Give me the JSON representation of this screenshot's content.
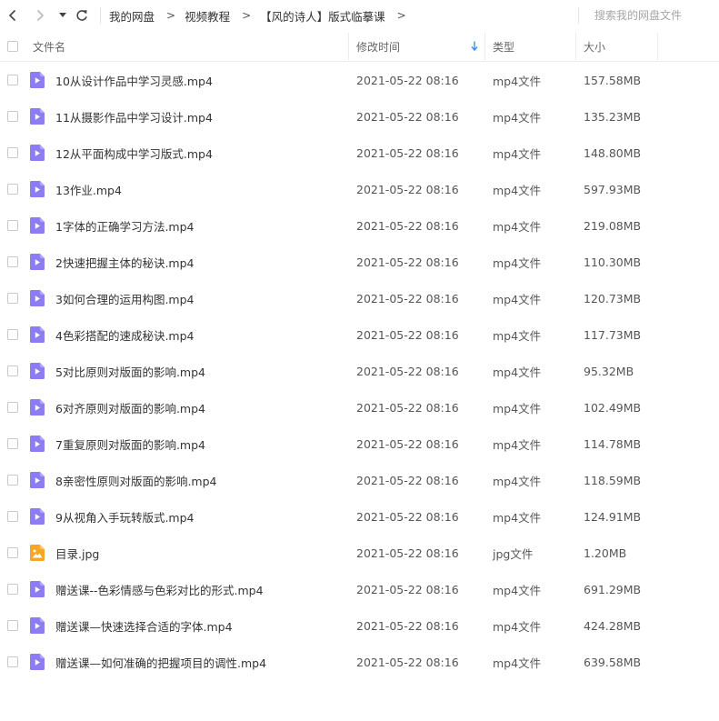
{
  "breadcrumb": [
    {
      "label": "我的网盘"
    },
    {
      "label": "视频教程"
    },
    {
      "label": "【风的诗人】版式临摹课"
    }
  ],
  "breadcrumb_separator": ">",
  "search": {
    "placeholder": "搜索我的网盘文件"
  },
  "columns": {
    "name": "文件名",
    "mtime": "修改时间",
    "type": "类型",
    "size": "大小"
  },
  "colors": {
    "video_icon": "#8c7ef0",
    "image_icon": "#f5a623",
    "sort_arrow": "#3a8ef6"
  },
  "files": [
    {
      "name": "10从设计作品中学习灵感.mp4",
      "mtime": "2021-05-22 08:16",
      "type": "mp4文件",
      "size": "157.58MB",
      "icon": "video-file-icon"
    },
    {
      "name": "11从摄影作品中学习设计.mp4",
      "mtime": "2021-05-22 08:16",
      "type": "mp4文件",
      "size": "135.23MB",
      "icon": "video-file-icon"
    },
    {
      "name": "12从平面构成中学习版式.mp4",
      "mtime": "2021-05-22 08:16",
      "type": "mp4文件",
      "size": "148.80MB",
      "icon": "video-file-icon"
    },
    {
      "name": "13作业.mp4",
      "mtime": "2021-05-22 08:16",
      "type": "mp4文件",
      "size": "597.93MB",
      "icon": "video-file-icon"
    },
    {
      "name": "1字体的正确学习方法.mp4",
      "mtime": "2021-05-22 08:16",
      "type": "mp4文件",
      "size": "219.08MB",
      "icon": "video-file-icon"
    },
    {
      "name": "2快速把握主体的秘诀.mp4",
      "mtime": "2021-05-22 08:16",
      "type": "mp4文件",
      "size": "110.30MB",
      "icon": "video-file-icon"
    },
    {
      "name": "3如何合理的运用构图.mp4",
      "mtime": "2021-05-22 08:16",
      "type": "mp4文件",
      "size": "120.73MB",
      "icon": "video-file-icon"
    },
    {
      "name": "4色彩搭配的速成秘诀.mp4",
      "mtime": "2021-05-22 08:16",
      "type": "mp4文件",
      "size": "117.73MB",
      "icon": "video-file-icon"
    },
    {
      "name": "5对比原则对版面的影响.mp4",
      "mtime": "2021-05-22 08:16",
      "type": "mp4文件",
      "size": "95.32MB",
      "icon": "video-file-icon"
    },
    {
      "name": "6对齐原则对版面的影响.mp4",
      "mtime": "2021-05-22 08:16",
      "type": "mp4文件",
      "size": "102.49MB",
      "icon": "video-file-icon"
    },
    {
      "name": "7重复原则对版面的影响.mp4",
      "mtime": "2021-05-22 08:16",
      "type": "mp4文件",
      "size": "114.78MB",
      "icon": "video-file-icon"
    },
    {
      "name": "8亲密性原则对版面的影响.mp4",
      "mtime": "2021-05-22 08:16",
      "type": "mp4文件",
      "size": "118.59MB",
      "icon": "video-file-icon"
    },
    {
      "name": "9从视角入手玩转版式.mp4",
      "mtime": "2021-05-22 08:16",
      "type": "mp4文件",
      "size": "124.91MB",
      "icon": "video-file-icon"
    },
    {
      "name": "目录.jpg",
      "mtime": "2021-05-22 08:16",
      "type": "jpg文件",
      "size": "1.20MB",
      "icon": "image-file-icon"
    },
    {
      "name": "赠送课--色彩情感与色彩对比的形式.mp4",
      "mtime": "2021-05-22 08:16",
      "type": "mp4文件",
      "size": "691.29MB",
      "icon": "video-file-icon"
    },
    {
      "name": "赠送课—快速选择合适的字体.mp4",
      "mtime": "2021-05-22 08:16",
      "type": "mp4文件",
      "size": "424.28MB",
      "icon": "video-file-icon"
    },
    {
      "name": "赠送课—如何准确的把握项目的调性.mp4",
      "mtime": "2021-05-22 08:16",
      "type": "mp4文件",
      "size": "639.58MB",
      "icon": "video-file-icon"
    }
  ]
}
